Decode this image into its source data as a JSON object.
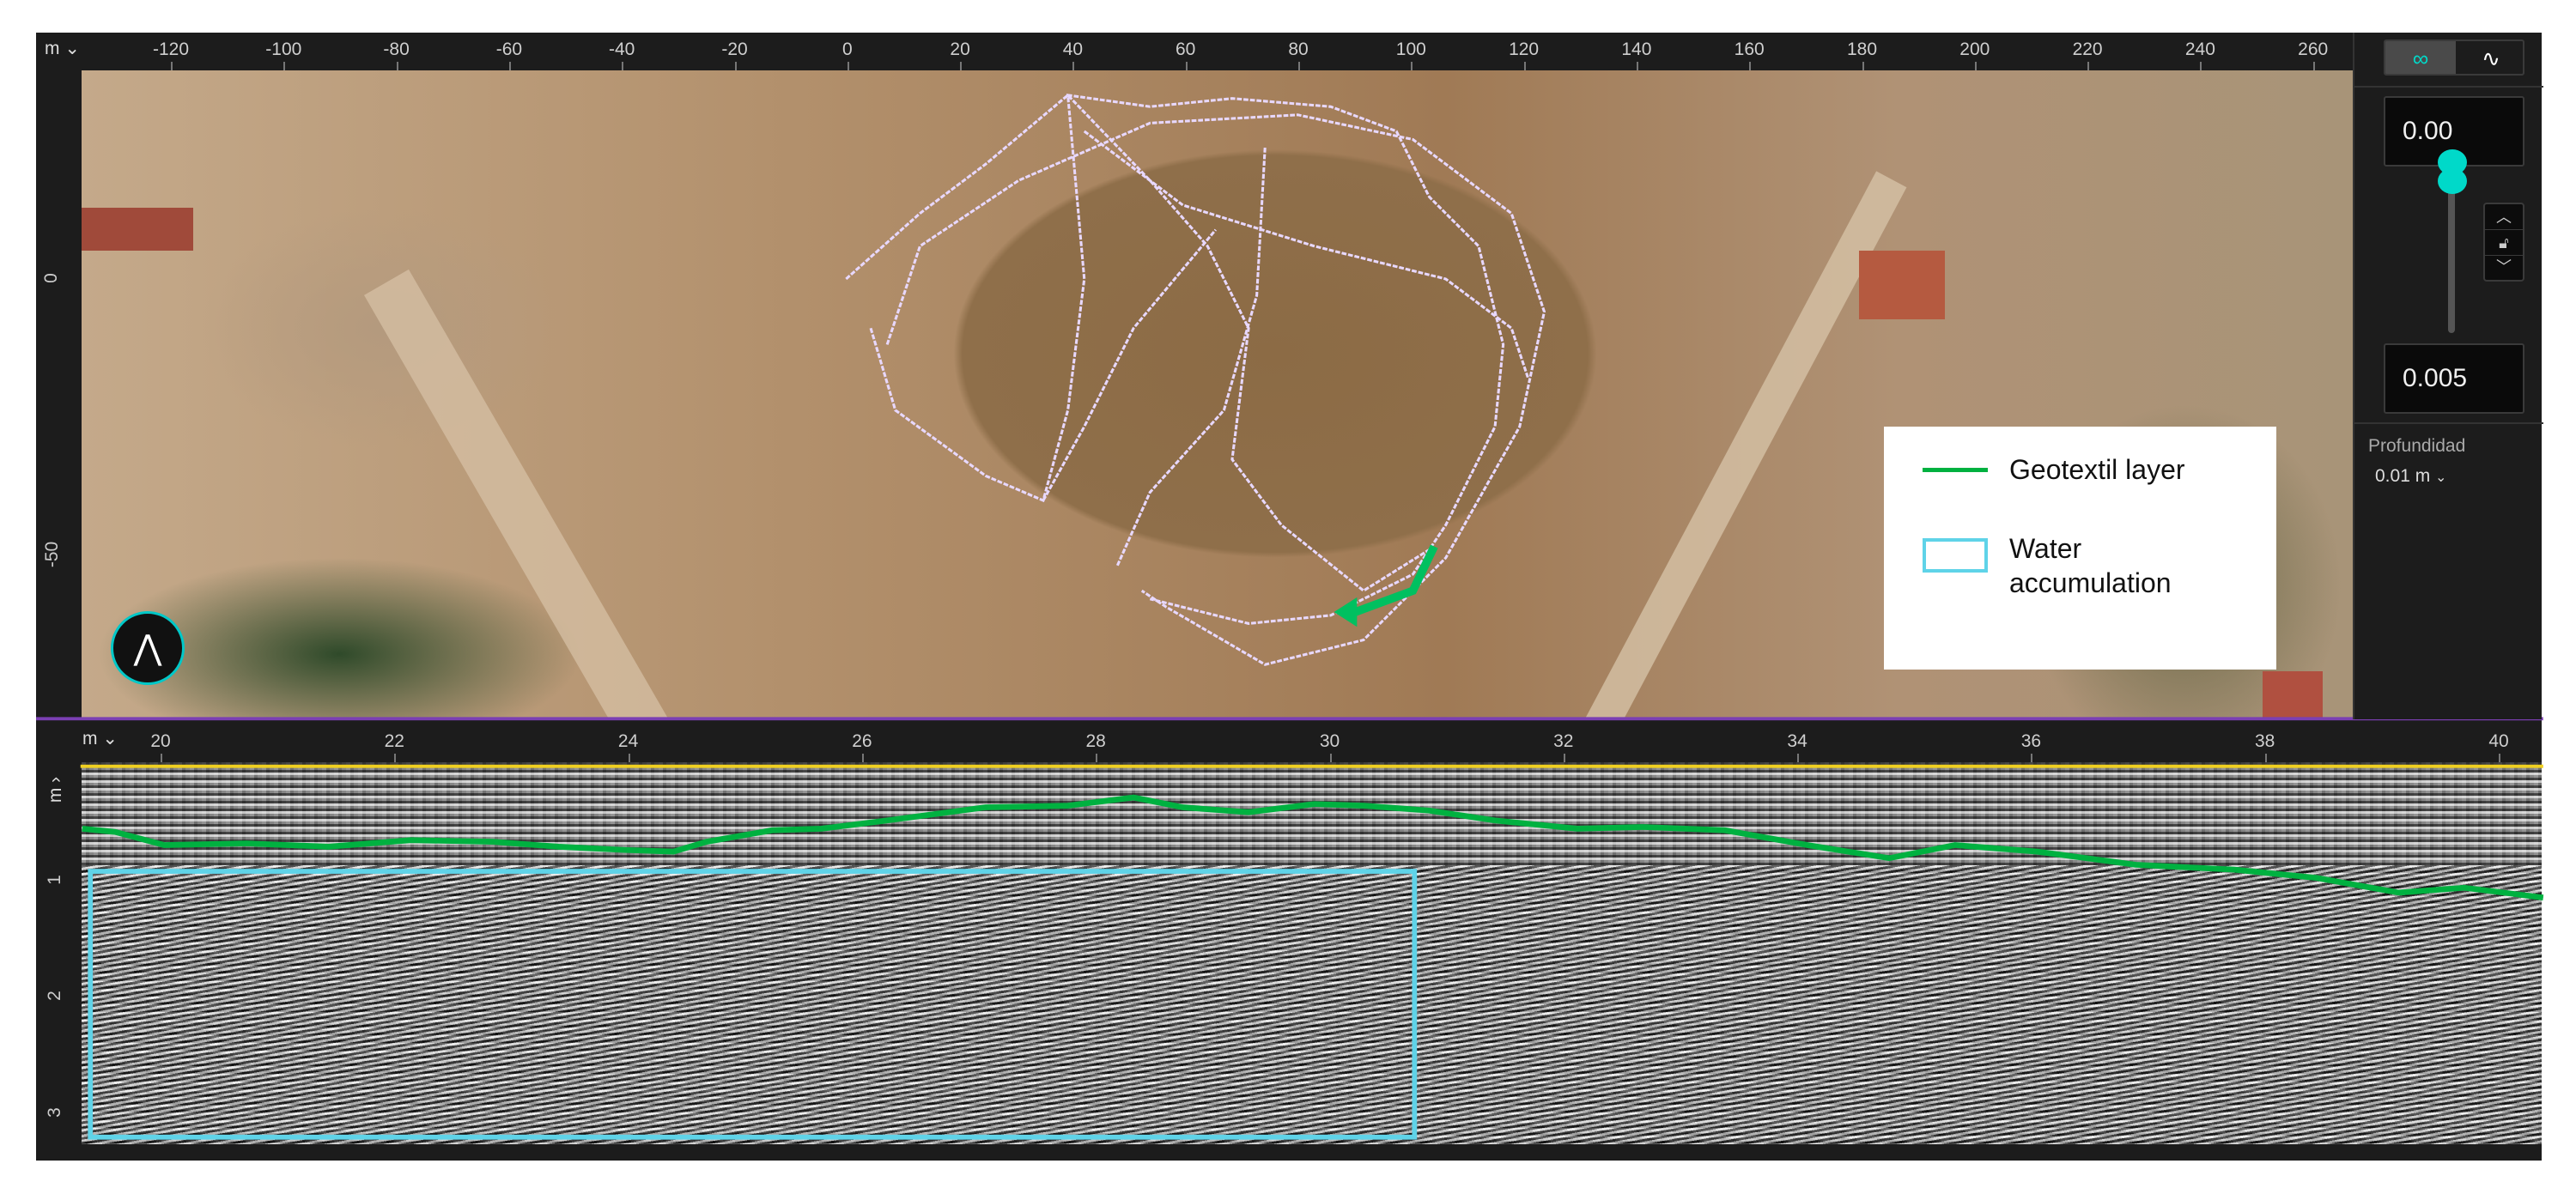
{
  "map_view": {
    "unit_selector": "m",
    "x_ticks": [
      "-120",
      "-100",
      "-80",
      "-60",
      "-40",
      "-20",
      "0",
      "20",
      "40",
      "60",
      "80",
      "100",
      "120",
      "140",
      "160",
      "180",
      "200",
      "220",
      "240",
      "260"
    ],
    "y_ticks": [
      "0",
      "-50"
    ]
  },
  "side_panel": {
    "max_value": "0.00",
    "min_value": "0.005",
    "depth_label": "Profundidad",
    "depth_value": "0.01 m",
    "accent_color": "#00d9c9"
  },
  "legend": {
    "items": [
      {
        "label": "Geotextil layer",
        "color": "#00b140"
      },
      {
        "label": "Water accumulation",
        "color": "#5fd3e8"
      }
    ]
  },
  "radargram": {
    "unit_selector_x": "m",
    "unit_selector_y": "m",
    "x_ticks": [
      "20",
      "22",
      "24",
      "26",
      "28",
      "30",
      "32",
      "34",
      "36",
      "38",
      "40"
    ],
    "depth_ticks": [
      "1",
      "2",
      "3"
    ]
  }
}
